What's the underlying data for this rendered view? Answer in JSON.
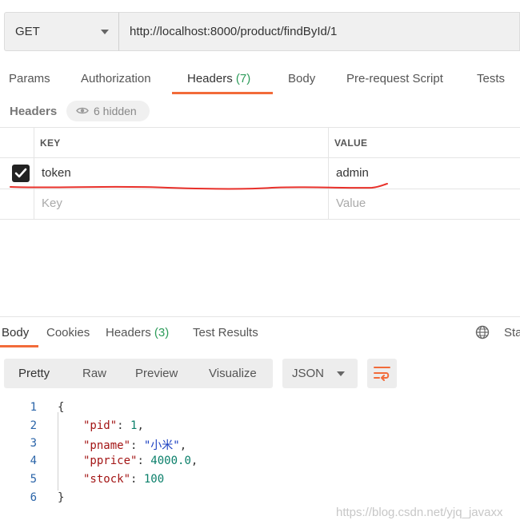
{
  "request": {
    "method": "GET",
    "url": "http://localhost:8000/product/findById/1"
  },
  "request_tabs": {
    "params": "Params",
    "authorization": "Authorization",
    "headers": "Headers",
    "headers_count": "(7)",
    "body": "Body",
    "prerequest": "Pre-request Script",
    "tests": "Tests"
  },
  "headers_section": {
    "title": "Headers",
    "hidden_label": "6 hidden"
  },
  "headers_table": {
    "col_key": "KEY",
    "col_value": "VALUE",
    "rows": [
      {
        "checked": true,
        "key": "token",
        "value": "admin"
      }
    ],
    "new_row": {
      "key_placeholder": "Key",
      "value_placeholder": "Value"
    }
  },
  "response_tabs": {
    "body": "Body",
    "cookies": "Cookies",
    "headers": "Headers",
    "headers_count": "(3)",
    "test_results": "Test Results",
    "status_partial": "Sta"
  },
  "format_bar": {
    "pretty": "Pretty",
    "raw": "Raw",
    "preview": "Preview",
    "visualize": "Visualize",
    "language": "JSON"
  },
  "response_body": {
    "line_numbers": [
      "1",
      "2",
      "3",
      "4",
      "5",
      "6"
    ],
    "open_brace": "{",
    "close_brace": "}",
    "fields": [
      {
        "key": "\"pid\"",
        "value": "1",
        "trail": ","
      },
      {
        "key": "\"pname\"",
        "value": "\"小米\"",
        "trail": ","
      },
      {
        "key": "\"pprice\"",
        "value": "4000.0",
        "trail": ","
      },
      {
        "key": "\"stock\"",
        "value": "100",
        "trail": ""
      }
    ]
  },
  "watermark": "https://blog.csdn.net/yjq_javaxx",
  "colors": {
    "accent": "#f26b3a",
    "count_green": "#2d9b5a",
    "annotation_red": "#e8302a"
  },
  "icons": [
    "chevron-down-icon",
    "eye-icon",
    "checkbox-checked-icon",
    "globe-icon",
    "wrap-lines-icon"
  ]
}
